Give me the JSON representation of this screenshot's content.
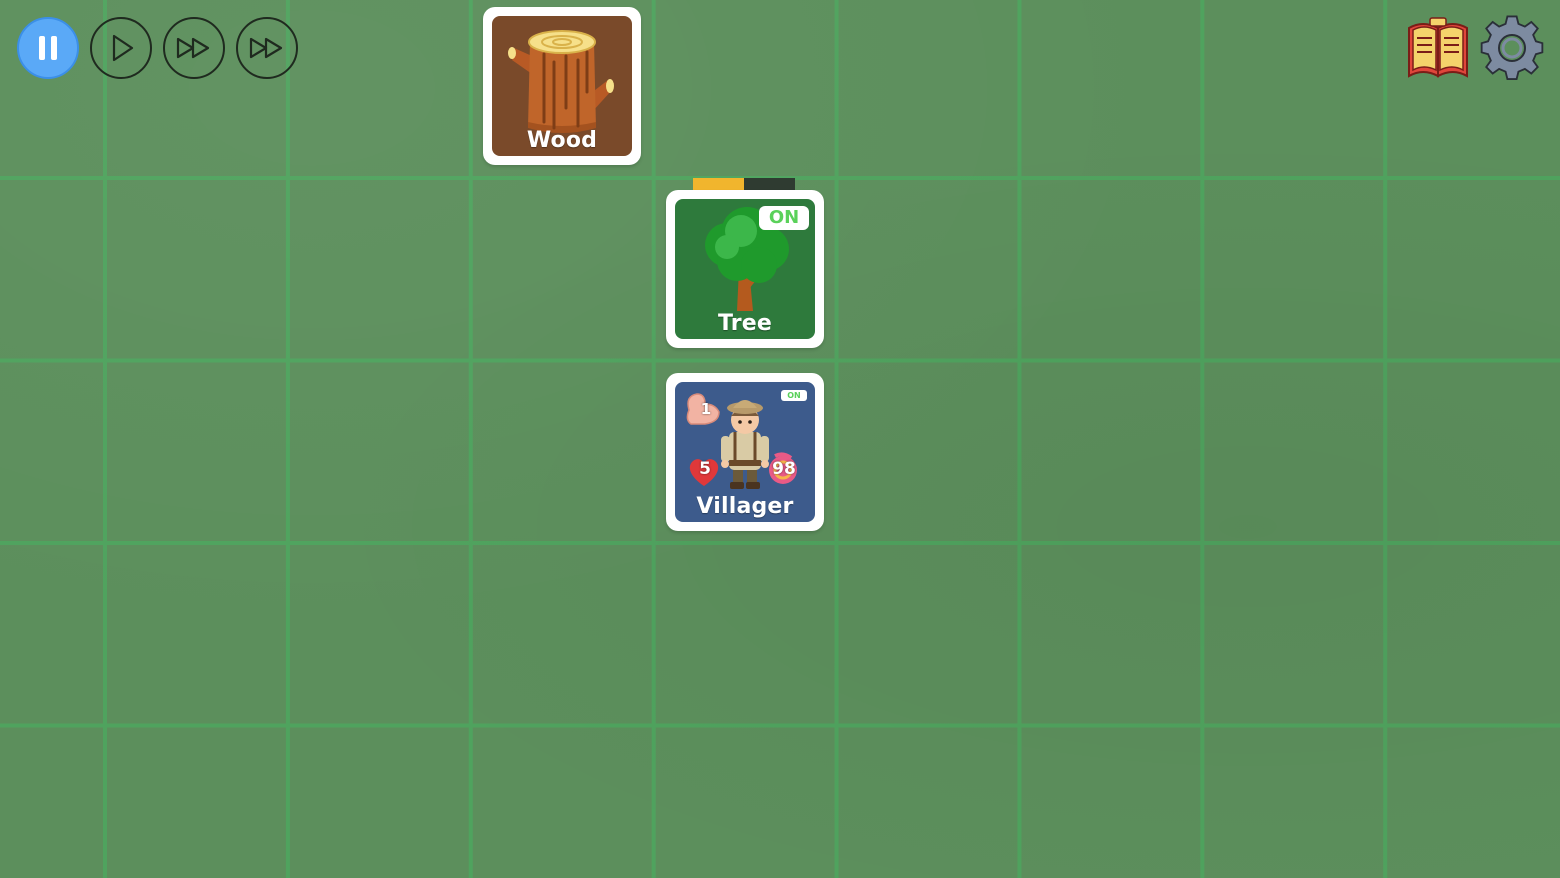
{
  "controls": {
    "pause_icon": "pause-icon",
    "play_icon": "play-icon",
    "fast_forward_icon": "fast-forward-icon",
    "faster_forward_icon": "fast-forward-icon",
    "active_color": "#5aa9f7"
  },
  "top_right": {
    "book_icon": "book-icon",
    "settings_icon": "gear-icon"
  },
  "cards": {
    "wood": {
      "label": "Wood",
      "icon": "log-icon",
      "color": "#7a4a2a"
    },
    "tree": {
      "label": "Tree",
      "icon": "tree-icon",
      "status": "ON",
      "progress": 0.5,
      "color": "#2e7a3c"
    },
    "villager": {
      "label": "Villager",
      "icon": "villager-icon",
      "status": "ON",
      "strength": "1",
      "health": "5",
      "food": "98",
      "color": "#3d5b8c"
    }
  },
  "colors": {
    "board": "#5c8f5c",
    "grid_line": "#4fa35e",
    "progress_fill": "#f1b52d",
    "on_text": "#5ad15a"
  }
}
